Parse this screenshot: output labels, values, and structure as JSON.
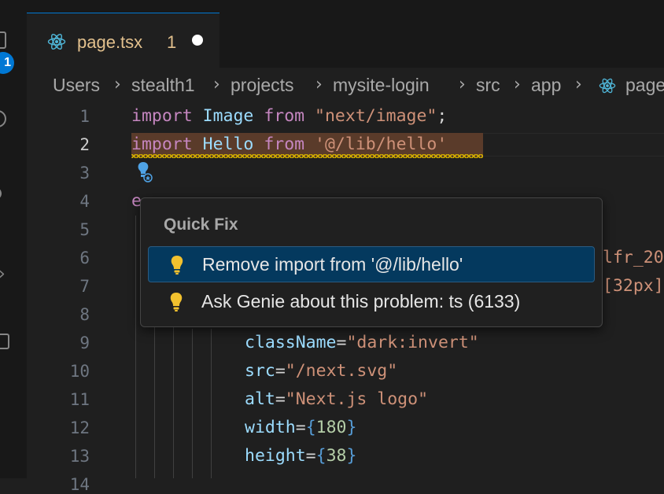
{
  "activity_bar": {
    "badge_count": "1"
  },
  "tab": {
    "title": "page.tsx",
    "problem_count": "1",
    "icon": "react-icon"
  },
  "breadcrumb": [
    "Users",
    "stealth1",
    "projects",
    "mysite-login",
    "src",
    "app",
    "page"
  ],
  "editor": {
    "line_numbers": [
      "1",
      "2",
      "3",
      "4",
      "5",
      "6",
      "7",
      "8",
      "9",
      "10",
      "11",
      "12",
      "13",
      "14"
    ],
    "active_line": "2",
    "lines": {
      "l1": {
        "kw1": "import",
        "id": "Image",
        "kw2": "from",
        "str": "\"next/image\"",
        "end": ";"
      },
      "l2": {
        "kw1": "import",
        "id": "Hello",
        "kw2": "from",
        "str": "'@/lib/hello'"
      },
      "l4": {
        "visible": "e"
      },
      "l6_right": "lfr_20",
      "l7_right": "[32px]",
      "l9": {
        "attr": "className",
        "eq": "=",
        "str": "\"dark:invert\""
      },
      "l10": {
        "attr": "src",
        "eq": "=",
        "str": "\"/next.svg\""
      },
      "l11": {
        "attr": "alt",
        "eq": "=",
        "str": "\"Next.js logo\""
      },
      "l12": {
        "attr": "width",
        "eq": "=",
        "open": "{",
        "num": "180",
        "close": "}"
      },
      "l13": {
        "attr": "height",
        "eq": "=",
        "open": "{",
        "num": "38",
        "close": "}"
      }
    }
  },
  "quick_fix": {
    "title": "Quick Fix",
    "items": [
      {
        "label": "Remove import from '@/lib/hello'",
        "icon": "lightbulb-icon",
        "selected": true
      },
      {
        "label": "Ask Genie about this problem: ts (6133)",
        "icon": "lightbulb-icon",
        "selected": false
      }
    ]
  },
  "colors": {
    "accent": "#0078d4",
    "bulb": "#f2c12e",
    "warning": "#cca700"
  }
}
